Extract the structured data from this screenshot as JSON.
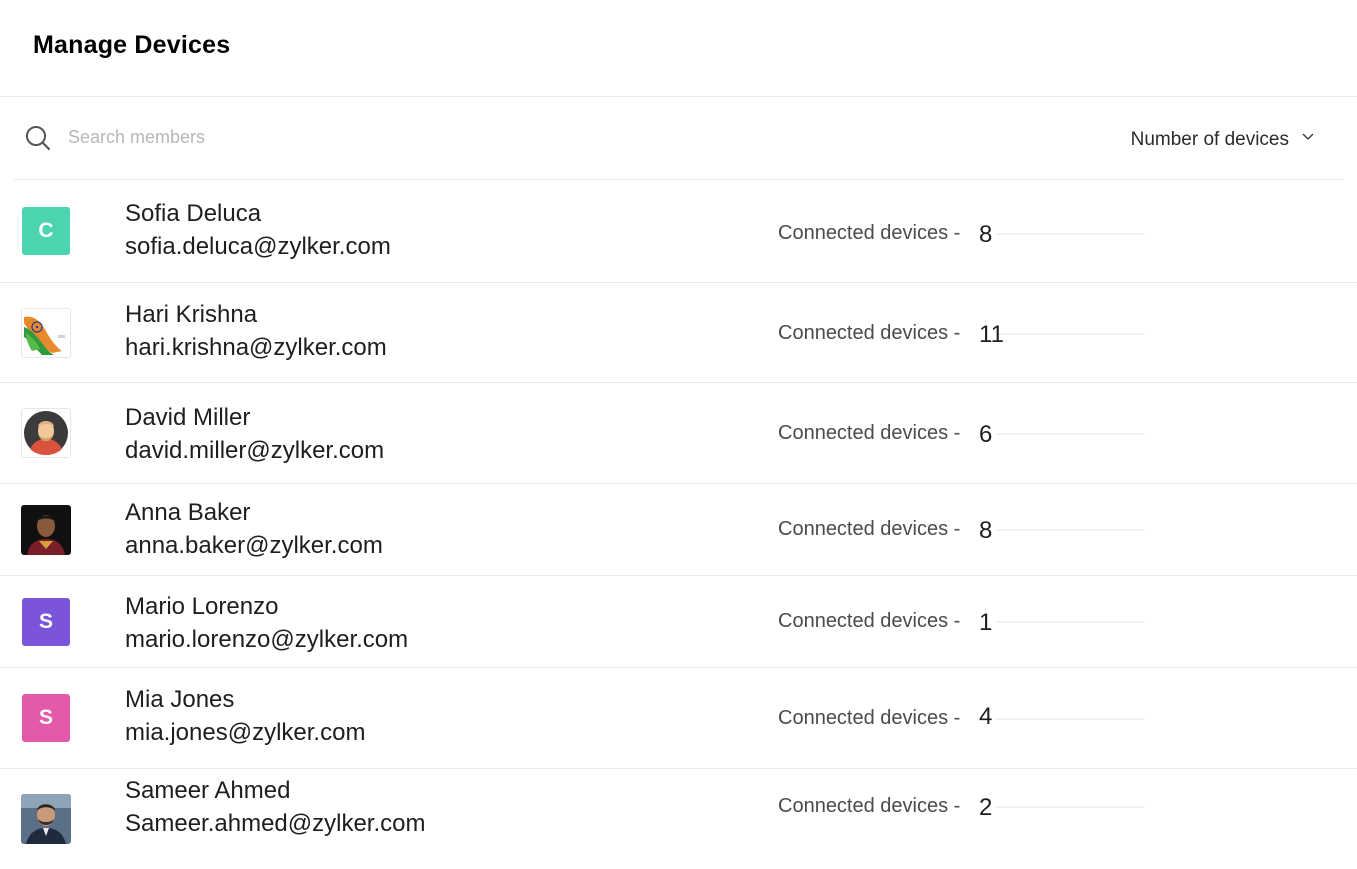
{
  "page": {
    "title": "Manage Devices"
  },
  "toolbar": {
    "search_placeholder": "Search members",
    "search_icon": "search-icon",
    "sort_label": "Number of devices",
    "sort_icon": "chevron-down-icon"
  },
  "members": [
    {
      "name": "Sofia Deluca",
      "email": "sofia.deluca@zylker.com",
      "devices_label": "Connected devices -",
      "count": "8",
      "avatar_type": "initial",
      "avatar_initial": "C",
      "avatar_color": "#4cd3b0"
    },
    {
      "name": "Hari Krishna",
      "email": "hari.krishna@zylker.com",
      "devices_label": "Connected devices -",
      "count": "11",
      "avatar_type": "photo",
      "avatar_icon": "flag-image-icon"
    },
    {
      "name": "David Miller",
      "email": "david.miller@zylker.com",
      "devices_label": "Connected devices -",
      "count": "6",
      "avatar_type": "photo",
      "avatar_icon": "user-illustration-icon"
    },
    {
      "name": "Anna Baker",
      "email": "anna.baker@zylker.com",
      "devices_label": "Connected devices -",
      "count": "8",
      "avatar_type": "photo",
      "avatar_icon": "user-photo-icon"
    },
    {
      "name": "Mario Lorenzo",
      "email": "mario.lorenzo@zylker.com",
      "devices_label": "Connected devices -",
      "count": "1",
      "avatar_type": "initial",
      "avatar_initial": "S",
      "avatar_color": "#7a55d9"
    },
    {
      "name": "Mia Jones",
      "email": "mia.jones@zylker.com",
      "devices_label": "Connected devices -",
      "count": "4",
      "avatar_type": "initial",
      "avatar_initial": "S",
      "avatar_color": "#e35aa8"
    },
    {
      "name": "Sameer Ahmed",
      "email": "Sameer.ahmed@zylker.com",
      "devices_label": "Connected devices -",
      "count": "2",
      "avatar_type": "photo",
      "avatar_icon": "user-photo-icon"
    }
  ]
}
